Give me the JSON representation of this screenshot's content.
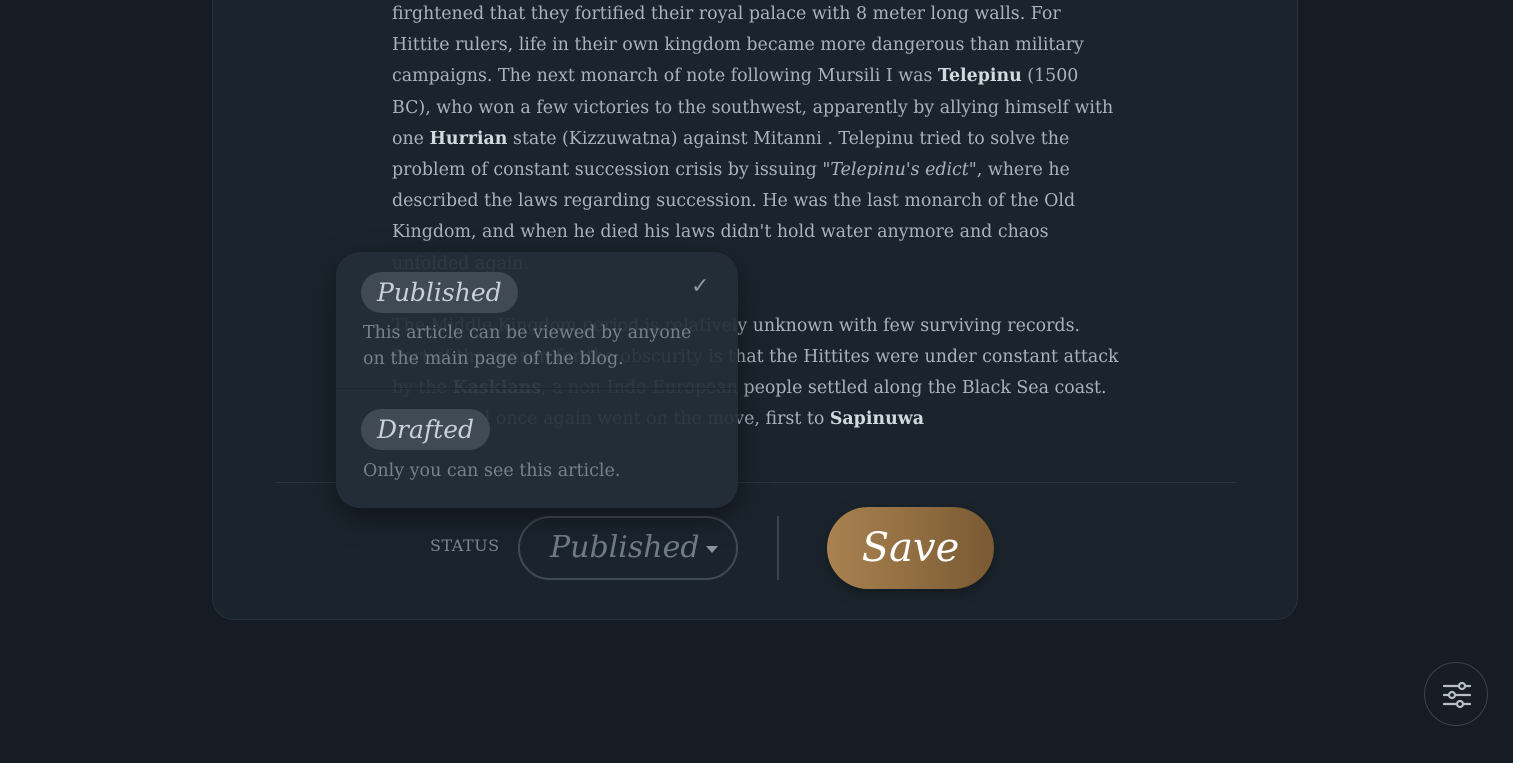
{
  "article": {
    "p1": [
      {
        "t": "firghtened that they fortified their royal palace with 8 meter long walls. For Hittite rulers, life in their own kingdom became more dangerous than military campaigns. The next monarch of note following Mursili I was ",
        "s": "normal"
      },
      {
        "t": "Telepinu",
        "s": "bold"
      },
      {
        "t": " (1500 BC), who won a few victories to the southwest, apparently by allying himself with one ",
        "s": "normal"
      },
      {
        "t": "Hurrian",
        "s": "bold"
      },
      {
        "t": " state (Kizzuwatna) against Mitanni . Telepinu tried to solve the problem of constant succession crisis by issuing \"",
        "s": "normal"
      },
      {
        "t": "Telepinu's edict",
        "s": "italic"
      },
      {
        "t": "\", where he described the laws regarding succession. He was the last monarch of the Old Kingdom, and when he died his laws didn't hold water anymore and chaos unfolded again.",
        "s": "normal"
      }
    ],
    "p2": [
      {
        "t": "The Middle Kingdom period is relatively unknown with few surviving records. Part of the reason for the obscurity is that the Hittites were under constant attack by the ",
        "s": "normal"
      },
      {
        "t": "Kaskians",
        "s": "bold"
      },
      {
        "t": ", a non-Indo-European people settled along the Black Sea coast. The capital once again went on the move, first to ",
        "s": "normal"
      },
      {
        "t": "Sapinuwa",
        "s": "bold"
      }
    ]
  },
  "footer": {
    "status_label": "STATUS",
    "status_value": "Published",
    "save_label": "Save"
  },
  "dropdown": {
    "options": [
      {
        "label": "Published",
        "description": "This article can be viewed by anyone on the main page of the blog.",
        "selected": true
      },
      {
        "label": "Drafted",
        "description": "Only you can see this article.",
        "selected": false
      }
    ],
    "check_glyph": "✓"
  },
  "colors": {
    "background": "#151c24",
    "card": "#1b242d",
    "accent_save": "#a98250",
    "text": "#a9b3bd"
  },
  "icons": {
    "settings_fab": "sliders-icon",
    "select_caret": "caret-down-icon",
    "selected_check": "check-icon"
  }
}
